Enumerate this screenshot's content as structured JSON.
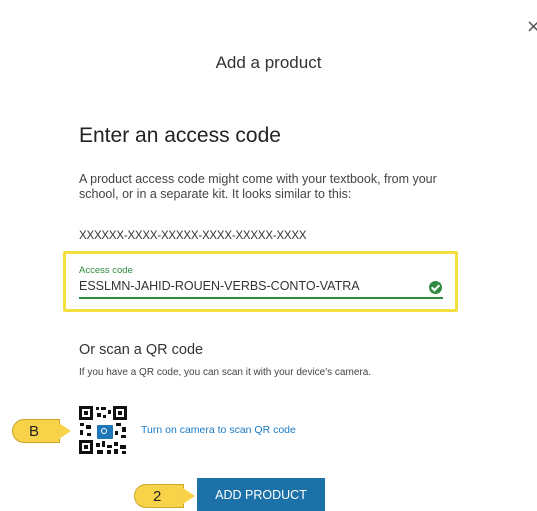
{
  "dialog": {
    "title": "Add a product",
    "close_glyph": "×"
  },
  "access_code": {
    "heading": "Enter an access code",
    "description": "A product access code might come with your textbook, from your school, or in a separate kit. It looks similar to this:",
    "sample_format": "XXXXXX-XXXX-XXXXX-XXXX-XXXXX-XXXX",
    "field_label": "Access code",
    "field_value": "ESSLMN-JAHID-ROUEN-VERBS-CONTO-VATRA",
    "status_icon": "check-circle-icon"
  },
  "qr": {
    "heading": "Or scan a QR code",
    "description": "If you have a QR code, you can scan it with your device's camera.",
    "camera_link": "Turn on camera to scan QR code"
  },
  "callouts": {
    "b": "B",
    "two": "2"
  },
  "actions": {
    "add_product": "ADD PRODUCT"
  },
  "colors": {
    "accent_green": "#2e8b3f",
    "highlight_yellow": "#f3e040",
    "callout_yellow": "#f8d34a",
    "primary_blue": "#1b71a8",
    "link_blue": "#1a7ac4"
  }
}
